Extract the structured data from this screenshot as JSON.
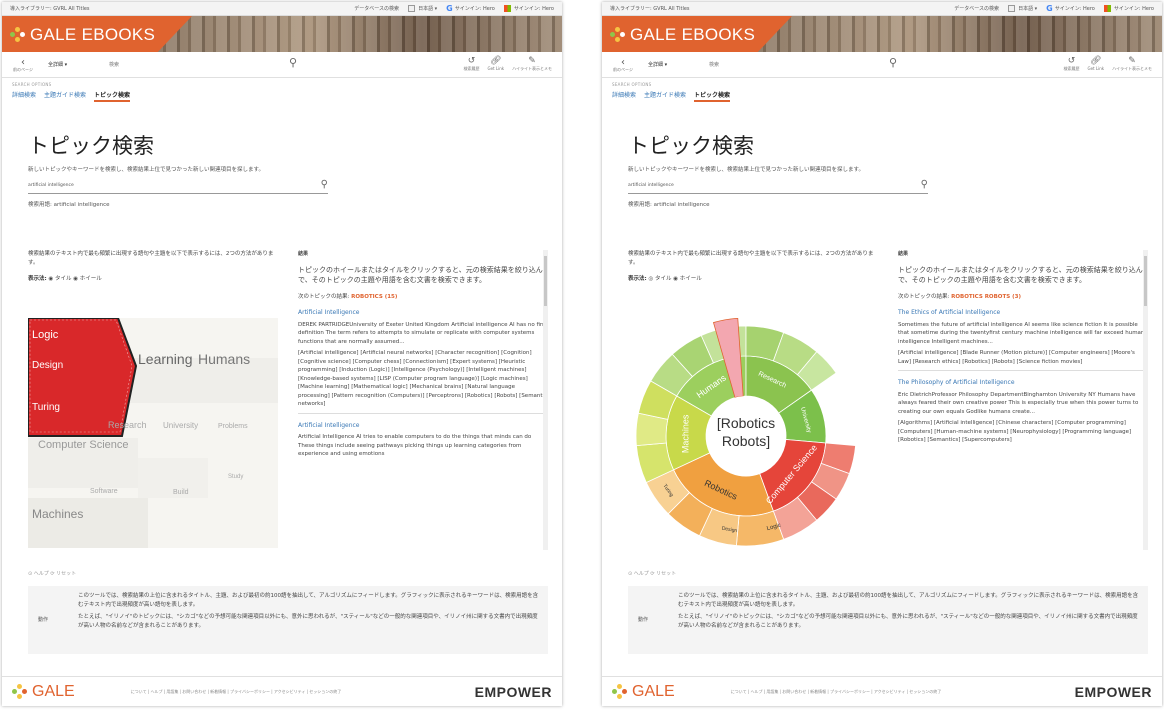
{
  "pages": [
    {
      "topbar": {
        "left": "導入ライブラリー: GVRL All Titles",
        "db_list": "データベースの検索",
        "lang": "日本語 ▾",
        "signin1": "サインイン: Hero",
        "signin2": "サインイン: Hero"
      },
      "brand": {
        "name": "GALE EBOOKS"
      },
      "search": {
        "back": "前のページ",
        "scope": "全詳細 ▾",
        "placeholder": "検索"
      },
      "tools": {
        "history": "検索履歴",
        "get_link": "Get Link",
        "highlight": "ハイライト表示とメモ"
      },
      "subnav": {
        "label": "SEARCH OPTIONS",
        "tab1": "詳細検索",
        "tab2": "主題ガイド検索",
        "tab3": "トピック検索"
      },
      "main": {
        "title": "トピック検索",
        "description": "新しいトピックやキーワードを検索し、検索結果上位で見つかった新しい関連項目を探します。",
        "query": "artificial intelligence",
        "term_label": "検索用語: artificial intelligence",
        "intro": "検索結果のテキスト内で最も頻繁に出現する語句や主題を以下で表示するには、2つの方法があります。",
        "display_label": "表示法:",
        "display_options": "◉ タイル  ◉ ホイール"
      },
      "results": {
        "header": "結果",
        "prompt": "トピックのホイールまたはタイルをクリックすると、元の検索結果を絞り込んで、そのトピックの主題や用語を含む文書を検索できます。",
        "next_label": "次のトピックの結果:",
        "next_topic": "ROBOTICS (15)",
        "articles": [
          {
            "title": "Artificial Intelligence",
            "body": "DEREK PARTRIDGEUniversity of Exeter United Kingdom Artificial intelligence AI has no firm definition The term refers to attempts to simulate or replicate with computer systems functions that are normally assumed...",
            "tags": "[Artificial intelligence] [Artificial neural networks] [Character recognition] [Cognition] [Cognitive science] [Computer chess] [Connectionism] [Expert systems] [Heuristic programming] [Induction (Logic)] [Intelligence (Psychology)] [Intelligent machines] [Knowledge-based systems] [LISP (Computer program language)] [Logic machines] [Machine learning] [Mathematical logic] [Mechanical brains] [Natural language processing] [Pattern recognition (Computers)] [Perceptrons] [Robotics] [Robots] [Semantic networks]"
          },
          {
            "title": "Artificial Intelligence",
            "body": "Artificial Intelligence AI tries to enable computers to do the things that minds can do These things include seeing pathways picking things up learning categories from experience and using emotions",
            "tags": ""
          }
        ]
      },
      "viz": {
        "tiles_red": [
          "Logic",
          "Design",
          "Turing"
        ],
        "tiles_words": [
          "Learning",
          "Humans",
          "Computer Science",
          "Research",
          "University",
          "Problems",
          "Software",
          "Build",
          "Study",
          "Machines"
        ]
      },
      "help": {
        "links": "⊙ ヘルプ   ⟳ リセット",
        "label": "動作",
        "p1": "このツールでは、検索結果の上位に含まれるタイトル、主題、および最初の約100語を抽出して、アルゴリズムにフィードします。グラフィックに表示されるキーワードは、検索用語を含むテキスト内で出現頻度が高い語句を表します。",
        "p2": "たとえば、\"イリノイ\"のトピックには、\"シカゴ\"などの予想可能な関連項目以外にも、意外に思われるが、\"スティール\"などの一般的な関連項目や、イリノイ州に関する文書内で出現頻度が高い人物の名前などが含まれることがあります。"
      },
      "footer": {
        "brand": "GALE",
        "links": "について | ヘルプ | 用語集 | お問い合わせ | 新着情報 | プライバシーポリシー | アクセシビリティ | セッションの終了",
        "partner": "EMPOWER"
      }
    },
    {
      "topbar": {
        "left": "導入ライブラリー: GVRL All Titles",
        "db_list": "データベースの検索",
        "lang": "日本語 ▾",
        "signin1": "サインイン: Hero",
        "signin2": "サインイン: Hero"
      },
      "brand": {
        "name": "GALE EBOOKS"
      },
      "search": {
        "back": "前のページ",
        "scope": "全詳細 ▾",
        "placeholder": "検索"
      },
      "tools": {
        "history": "検索履歴",
        "get_link": "Get Link",
        "highlight": "ハイライト表示とメモ"
      },
      "subnav": {
        "label": "SEARCH OPTIONS",
        "tab1": "詳細検索",
        "tab2": "主題ガイド検索",
        "tab3": "トピック検索"
      },
      "main": {
        "title": "トピック検索",
        "description": "新しいトピックやキーワードを検索し、検索結果上位で見つかった新しい関連項目を探します。",
        "query": "artificial intelligence",
        "term_label": "検索用語: artificial intelligence",
        "intro": "検索結果のテキスト内で最も頻繁に出現する語句や主題を以下で表示するには、2つの方法があります。",
        "display_label": "表示法:",
        "display_options": "◎ タイル  ◉ ホイール"
      },
      "results": {
        "header": "結果",
        "prompt": "トピックのホイールまたはタイルをクリックすると、元の検索結果を絞り込んで、そのトピックの主題や用語を含む文書を検索できます。",
        "next_label": "次のトピックの結果:",
        "next_topic": "ROBOTICS ROBOTS (3)",
        "articles": [
          {
            "title": "The Ethics of Artificial Intelligence",
            "body": "Sometimes the future of artificial intelligence AI seems like science fiction It is possible that sometime during the twentyfirst century machine intelligence will far exceed human intelligence Intelligent machines...",
            "tags": "[Artificial intelligence] [Blade Runner (Motion picture)] [Computer engineers] [Moore's Law] [Research ethics] [Robotics] [Robots] [Science fiction movies]"
          },
          {
            "title": "The Philosophy of Artificial Intelligence",
            "body": "Eric DietrichProfessor Philosophy DepartmentBinghamton University NY Humans have always feared their own creative power This is especially true when this power turns to creating our own equals Godlike humans create...",
            "tags": "[Algorithms] [Artificial intelligence] [Chinese characters] [Computer programming] [Computers] [Human-machine systems] [Neurophysiology] [Programming language] [Robotics] [Semantics] [Supercomputers]"
          }
        ]
      },
      "viz": {
        "center": "[Robotics Robots]",
        "segments": [
          "Humans",
          "Research",
          "University",
          "Machines",
          "Robotics",
          "Computer Science",
          "Turing",
          "Design",
          "Logic"
        ]
      },
      "help": {
        "links": "⊙ ヘルプ   ⟳ リセット",
        "label": "動作",
        "p1": "このツールでは、検索結果の上位に含まれるタイトル、主題、および最初の約100語を抽出して、アルゴリズムにフィードします。グラフィックに表示されるキーワードは、検索用語を含むテキスト内で出現頻度が高い語句を表します。",
        "p2": "たとえば、\"イリノイ\"のトピックには、\"シカゴ\"などの予想可能な関連項目以外にも、意外に思われるが、\"スティール\"などの一般的な関連項目や、イリノイ州に関する文書内で出現頻度が高い人物の名前などが含まれることがあります。"
      },
      "footer": {
        "brand": "GALE",
        "links": "について | ヘルプ | 用語集 | お問い合わせ | 新着情報 | プライバシーポリシー | アクセシビリティ | セッションの終了",
        "partner": "EMPOWER"
      }
    }
  ],
  "colors": {
    "accent": "#e0632f",
    "link": "#3a78b5",
    "tile_red": "#d9282a",
    "wheel_green": "#7cc04b",
    "wheel_orange": "#f0a040",
    "wheel_red": "#e34a3a",
    "wheel_yellow": "#c8d94a"
  }
}
